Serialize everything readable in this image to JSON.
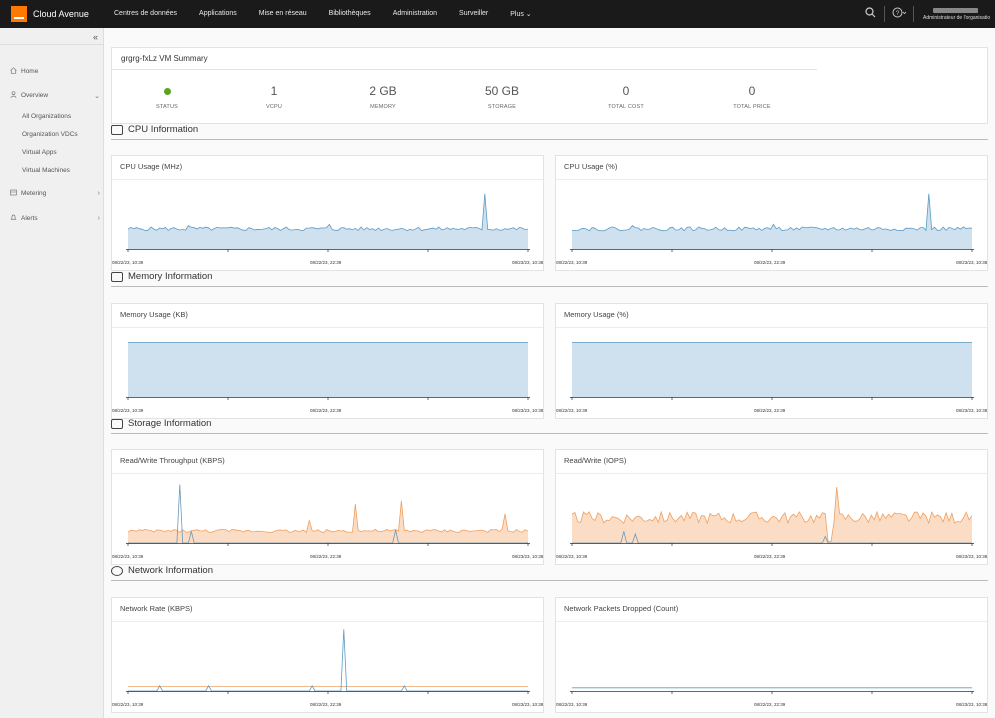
{
  "app": {
    "name": "Cloud Avenue"
  },
  "nav": [
    "Centres de données",
    "Applications",
    "Mise en réseau",
    "Bibliothèques",
    "Administration",
    "Surveiller",
    "Plus"
  ],
  "topbar": {
    "user_role": "Administrateur de l'organisatio"
  },
  "sidebar": {
    "items": [
      {
        "label": "Home"
      },
      {
        "label": "Overview"
      },
      {
        "label": "Metering"
      },
      {
        "label": "Alerts"
      }
    ],
    "subitems": [
      "All Organizations",
      "Organization VDCs",
      "Virtual Apps",
      "Virtual Machines"
    ]
  },
  "summary": {
    "title": "grgrg-fxLz VM Summary",
    "stats": [
      {
        "value": "",
        "label": "STATUS",
        "status_color": "#5aa220"
      },
      {
        "value": "1",
        "label": "VCPU"
      },
      {
        "value": "2 GB",
        "label": "MEMORY"
      },
      {
        "value": "50 GB",
        "label": "STORAGE"
      },
      {
        "value": "0",
        "label": "TOTAL COST"
      },
      {
        "value": "0",
        "label": "TOTAL PRICE"
      }
    ]
  },
  "sections": [
    {
      "title": "CPU Information"
    },
    {
      "title": "Memory Information"
    },
    {
      "title": "Storage Information"
    },
    {
      "title": "Network Information"
    }
  ],
  "ticks": [
    "08/22/23, 10:39",
    "08/22/23, 22:39",
    "08/23/23, 10:38"
  ],
  "chart_data": [
    {
      "type": "area",
      "title": "CPU Usage (MHz)",
      "color": "#5b9cc6",
      "fill": "#cfe0ee",
      "profile": "cpu"
    },
    {
      "type": "area",
      "title": "CPU Usage (%)",
      "color": "#5b9cc6",
      "fill": "#cfe0ee",
      "profile": "cpu"
    },
    {
      "type": "area",
      "title": "Memory Usage (KB)",
      "color": "#5b9cc6",
      "fill": "#cfe0ee",
      "profile": "flat"
    },
    {
      "type": "area",
      "title": "Memory Usage (%)",
      "color": "#5b9cc6",
      "fill": "#cfe0ee",
      "profile": "flat"
    },
    {
      "type": "area",
      "title": "Read/Write Throughput (KBPS)",
      "color": "#f0a060",
      "fill": "#fbdcc4",
      "profile": "rw"
    },
    {
      "type": "area",
      "title": "Read/Write (IOPS)",
      "color": "#f0a060",
      "fill": "#fbdcc4",
      "profile": "iops"
    },
    {
      "type": "line",
      "title": "Network Rate (KBPS)",
      "color": "#f0a060",
      "fill": "#fbdcc4",
      "profile": "net"
    },
    {
      "type": "line",
      "title": "Network Packets Dropped (Count)",
      "color": "#5b9cc6",
      "fill": "#cfe0ee",
      "profile": "drop"
    }
  ]
}
